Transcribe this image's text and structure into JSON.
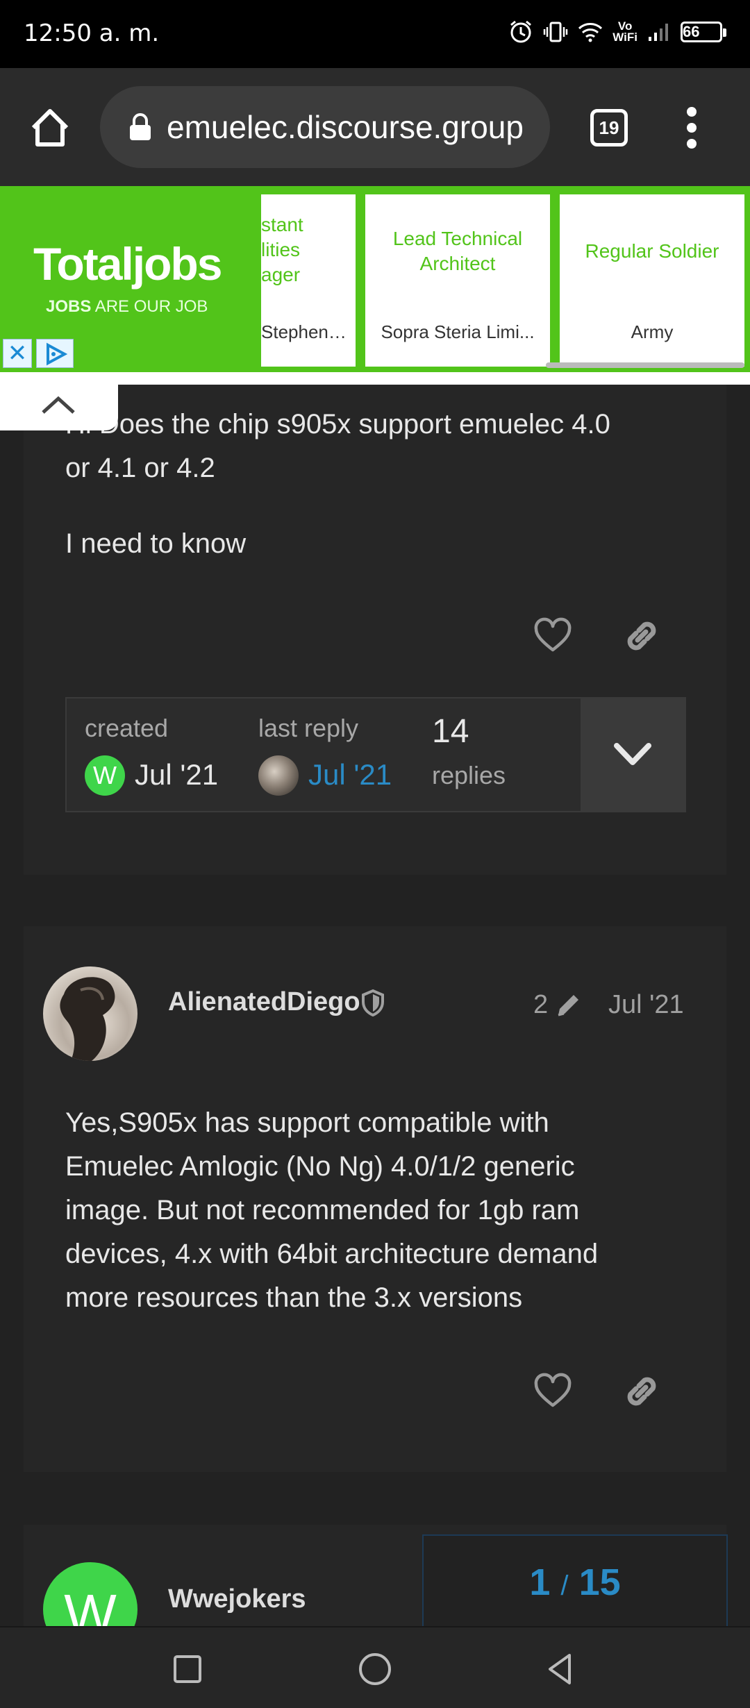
{
  "status_bar": {
    "time": "12:50 a. m.",
    "vowifi_line1": "Vo",
    "vowifi_line2": "WiFi",
    "battery": "66"
  },
  "browser": {
    "url": "emuelec.discourse.group",
    "tab_count": "19"
  },
  "ad": {
    "brand": "Totaljobs",
    "tagline_bold": "JOBS",
    "tagline_rest": " ARE OUR JOB",
    "close_glyph": "✕",
    "cards": [
      {
        "title_lines": [
          "stant",
          "lities",
          "ager"
        ],
        "company": "Stephens..."
      },
      {
        "title_lines": [
          "Lead Technical",
          "Architect"
        ],
        "company": "Sopra Steria Limi..."
      },
      {
        "title_lines": [
          "Regular Soldier"
        ],
        "company": "Army"
      }
    ],
    "accent_color": "#52c41a"
  },
  "first_post": {
    "line1": "Hi Does the chip s905x support emuelec 4.0",
    "line2": "or 4.1 or 4.2",
    "line3": "I need to know"
  },
  "topic_map": {
    "created_label": "created",
    "created_date": "Jul '21",
    "created_avatar_letter": "W",
    "last_reply_label": "last reply",
    "last_reply_date": "Jul '21",
    "replies_count": "14",
    "replies_label": "replies"
  },
  "second_post": {
    "username": "AlienatedDiego",
    "edit_count": "2",
    "date": "Jul '21",
    "lines": [
      "Yes,S905x has support compatible with",
      "Emuelec Amlogic (No Ng) 4.0/1/2 generic",
      "image. But not recommended for 1gb ram",
      "devices, 4.x with 64bit architecture demand",
      "more resources than the 3.x versions"
    ]
  },
  "third_post": {
    "username": "Wwejokers",
    "avatar_letter": "W"
  },
  "timeline": {
    "current": "1",
    "separator": "/",
    "total": "15"
  }
}
